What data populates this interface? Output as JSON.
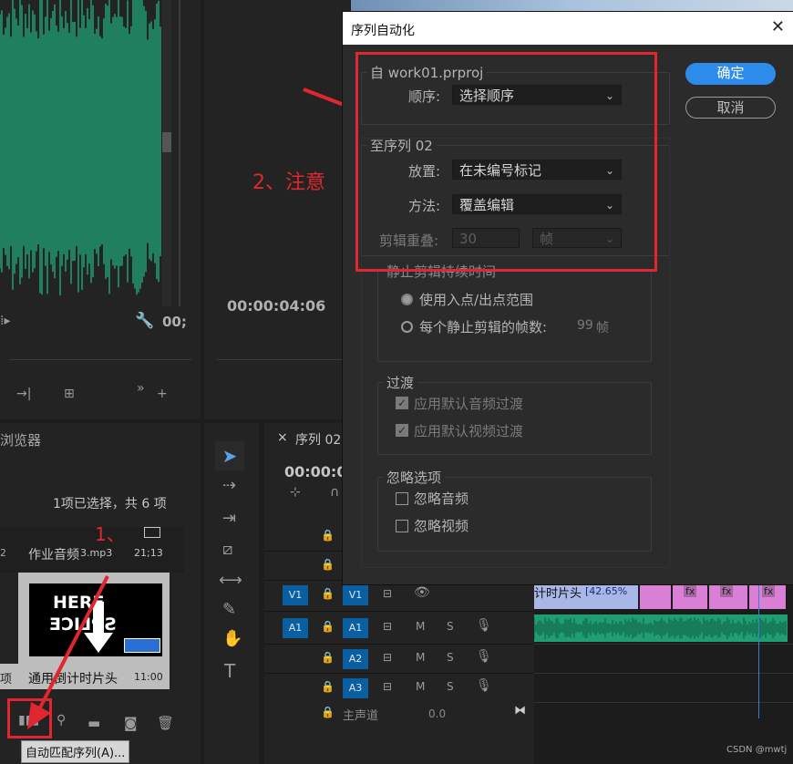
{
  "source_monitor": {
    "timecode": "00;"
  },
  "program_monitor": {
    "timecode": "00:00:04:06"
  },
  "browser": {
    "title": "浏览器",
    "selection": "1项已选择，共 6 项"
  },
  "media": [
    {
      "name": "作业音频",
      "ext": "3.mp3",
      "duration": "21;13",
      "prefix": "2"
    },
    {
      "name": "通用倒计时片头",
      "duration": "11:00",
      "thumb_line1": "HERE",
      "thumb_line2": "SPLICE",
      "prefix": "项"
    }
  ],
  "tooltip": "自动匹配序列(A)...",
  "timeline": {
    "tab": "序列 02",
    "close": "×",
    "timecode": "00:00:0",
    "tracks": [
      {
        "src": "V1",
        "dst": "V1"
      },
      {
        "src": "A1",
        "dst": "A1"
      },
      {
        "src": "",
        "dst": "A2"
      },
      {
        "src": "",
        "dst": "A3"
      }
    ],
    "master": "主声道",
    "master_val": "0.0",
    "clip_label": "计时片头",
    "clip_pct": "[42.65%",
    "fx": "fx"
  },
  "annotations": {
    "step1": "1、",
    "step2": "2、注意"
  },
  "dialog": {
    "title": "序列自动化",
    "ok": "确定",
    "cancel": "取消",
    "from_legend": "自  work01.prproj",
    "order_label": "顺序:",
    "order_value": "选择顺序",
    "to_legend": "至序列 02",
    "placement_label": "放置:",
    "placement_value": "在未编号标记",
    "method_label": "方法:",
    "method_value": "覆盖编辑",
    "overlap_label": "剪辑重叠:",
    "overlap_value": "30",
    "overlap_unit": "帧",
    "still_legend": "静止剪辑持续时间",
    "radio1": "使用入点/出点范围",
    "radio2": "每个静止剪辑的帧数:",
    "radio2_value": "99",
    "radio2_unit": "帧",
    "trans_legend": "过渡",
    "chk_audio_trans": "应用默认音频过渡",
    "chk_video_trans": "应用默认视频过渡",
    "ignore_legend": "忽略选项",
    "chk_ignore_audio": "忽略音频",
    "chk_ignore_video": "忽略视频"
  },
  "watermark": "CSDN @mwtj",
  "colors": {
    "accent": "#2d8ceb",
    "annotation": "#e0262e",
    "track_blue": "#0a5fa0",
    "waveform": "#1f9e72",
    "clip_pink": "#d97fd6"
  }
}
